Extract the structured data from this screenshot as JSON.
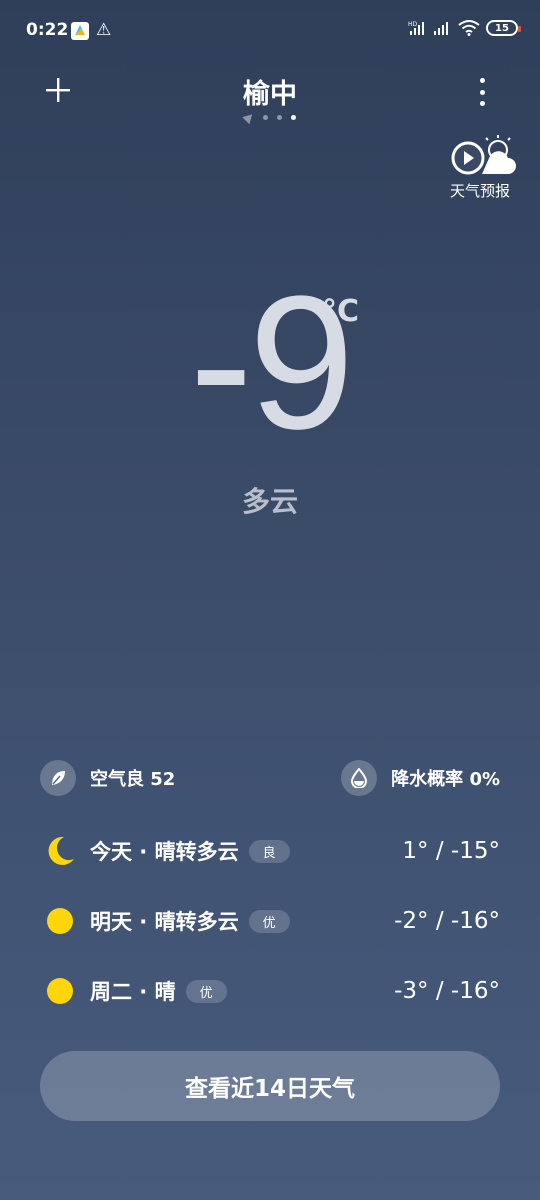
{
  "status": {
    "time": "0:22",
    "warning_icon": "warning-triangle-icon",
    "network": "HD",
    "battery": "15"
  },
  "header": {
    "city": "榆中",
    "add_icon": "plus-icon",
    "more_icon": "more-vertical-icon"
  },
  "forecast_button": {
    "label": "天气预报"
  },
  "current": {
    "temperature": "-9",
    "unit": "°C",
    "condition": "多云"
  },
  "info": {
    "air_quality": "空气良 52",
    "precipitation": "降水概率 0%"
  },
  "daily": [
    {
      "label": "今天 · 晴转多云",
      "badge": "良",
      "temps": "1° / -15°",
      "icon": "moon-icon"
    },
    {
      "label": "明天 · 晴转多云",
      "badge": "优",
      "temps": "-2° / -16°",
      "icon": "sun-icon"
    },
    {
      "label": "周二 · 晴",
      "badge": "优",
      "temps": "-3° / -16°",
      "icon": "sun-icon"
    }
  ],
  "bottom_button": {
    "label": "查看近14日天气"
  },
  "colors": {
    "sun": "#ffd60a",
    "bg_top": "#2f3f5a",
    "bg_bottom": "#475b7d"
  }
}
